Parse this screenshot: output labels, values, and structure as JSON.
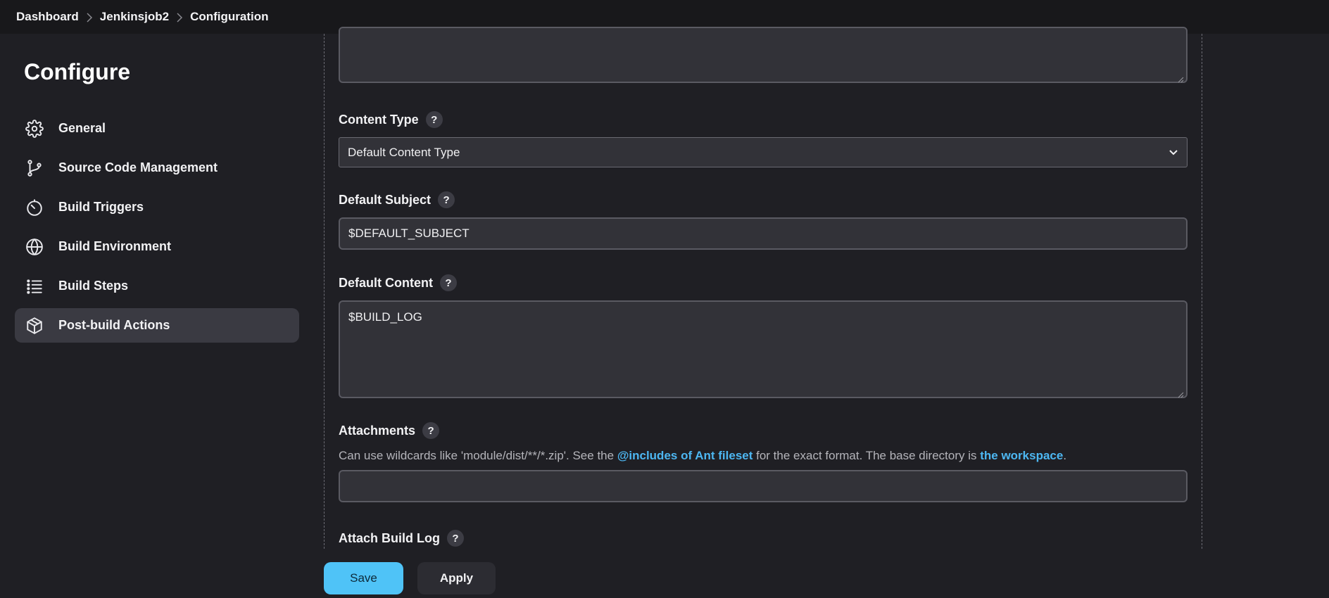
{
  "breadcrumb": {
    "items": [
      "Dashboard",
      "Jenkinsjob2",
      "Configuration"
    ]
  },
  "sidebar": {
    "title": "Configure",
    "items": [
      {
        "label": "General",
        "icon": "gear-icon"
      },
      {
        "label": "Source Code Management",
        "icon": "git-branch-icon"
      },
      {
        "label": "Build Triggers",
        "icon": "timer-icon"
      },
      {
        "label": "Build Environment",
        "icon": "globe-icon"
      },
      {
        "label": "Build Steps",
        "icon": "list-icon"
      },
      {
        "label": "Post-build Actions",
        "icon": "cube-icon",
        "active": true
      }
    ]
  },
  "form": {
    "content_type": {
      "label": "Content Type",
      "help": "?",
      "selected": "Default Content Type"
    },
    "default_subject": {
      "label": "Default Subject",
      "help": "?",
      "value": "$DEFAULT_SUBJECT"
    },
    "default_content": {
      "label": "Default Content",
      "help": "?",
      "value": "$BUILD_LOG"
    },
    "attachments": {
      "label": "Attachments",
      "help": "?",
      "desc_part1": "Can use wildcards like 'module/dist/**/*.zip'. See the ",
      "desc_link1": "@includes of Ant fileset",
      "desc_part2": " for the exact format. The base directory is ",
      "desc_link2": "the workspace",
      "desc_part3": ".",
      "value": ""
    },
    "attach_build_log": {
      "label": "Attach Build Log",
      "help": "?"
    }
  },
  "actions": {
    "save_label": "Save",
    "apply_label": "Apply"
  },
  "colors": {
    "accent": "#4fc3f7",
    "link": "#4db7f2",
    "background": "#1f1f24"
  }
}
